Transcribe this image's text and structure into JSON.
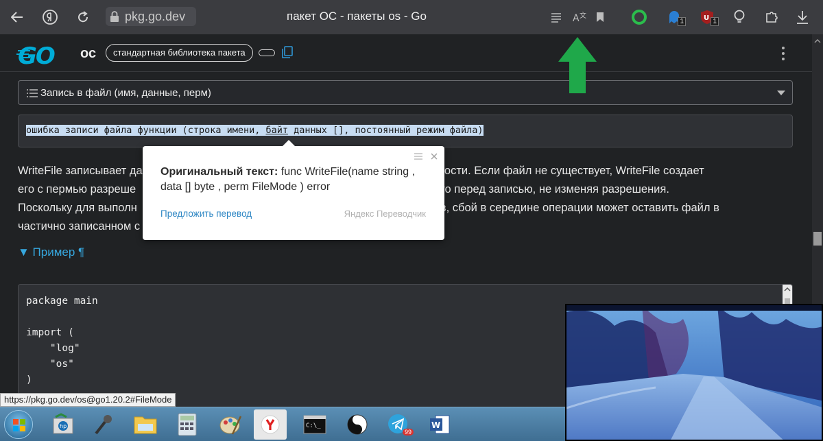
{
  "browser": {
    "address": "pkg.go.dev",
    "tab_title": "пакет ОС - пакеты os - Go",
    "ext_badges": [
      "1",
      "1"
    ]
  },
  "header": {
    "logo_text": "GO",
    "package_name": "ос",
    "badge": "стандартная библиотека пакета"
  },
  "nav": {
    "selected": "Запись в файл (имя, данные, перм)"
  },
  "signature": {
    "text_pre": "ошибка записи файла функции (строка имени, ",
    "text_underlined": "байт",
    "text_post": " данных [], постоянный режим файла)"
  },
  "description": {
    "line1_left": "WriteFile записывает да",
    "line1_right": "димости. Если файл не существует, WriteFile создает",
    "line2_left": "его с пермью разреше",
    "line2_right": "зает его перед записью, не изменяя разрешения.",
    "line3_left": "Поскольку для выполн",
    "line3_right": "в, сбой в середине операции может оставить файл в",
    "line4_left": "частично записанном с"
  },
  "example": {
    "label": "▼ Пример ¶"
  },
  "code": {
    "text": "package main\n\nimport (\n    \"log\"\n    \"os\"\n)"
  },
  "popup": {
    "label": "Оригинальный текст:",
    "original": " func WriteFile(name string , data [] byte , perm  FileMode )  error",
    "suggest_link": "Предложить перевод",
    "brand": "Яндекс Переводчик"
  },
  "status_url": "https://pkg.go.dev/os@go1.20.2#FileMode",
  "taskbar": {
    "telegram_badge": "99"
  },
  "colors": {
    "accent": "#36a7de",
    "go_brand": "#00acd7",
    "selection": "#c7dcf2",
    "arrow": "#1fa84a"
  }
}
